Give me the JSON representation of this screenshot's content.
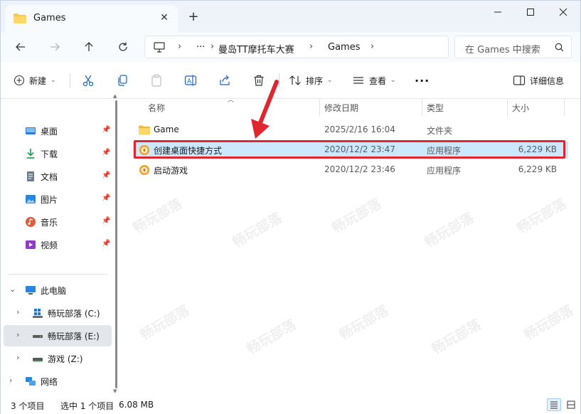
{
  "window": {
    "tab_title": "Games",
    "new_tab_label": "+",
    "close_tab_label": "✕"
  },
  "address": {
    "ellipsis": "···",
    "crumbs": [
      "曼岛TT摩托车大赛",
      "Games"
    ],
    "search_placeholder": "在 Games 中搜索"
  },
  "toolbar": {
    "new_label": "新建",
    "sort_label": "排序",
    "view_label": "查看",
    "more_label": "···",
    "details_label": "详细信息"
  },
  "sidebar": {
    "quick_access": [
      {
        "label": "桌面",
        "icon": "desktop-icon"
      },
      {
        "label": "下载",
        "icon": "download-icon"
      },
      {
        "label": "文档",
        "icon": "document-icon"
      },
      {
        "label": "图片",
        "icon": "picture-icon"
      },
      {
        "label": "音乐",
        "icon": "music-icon"
      },
      {
        "label": "视频",
        "icon": "video-icon"
      }
    ],
    "this_pc": "此电脑",
    "drives": [
      {
        "label": "畅玩部落 (C:)",
        "icon": "windows-drive-icon"
      },
      {
        "label": "畅玩部落 (E:)",
        "icon": "drive-icon"
      },
      {
        "label": "游戏 (Z:)",
        "icon": "drive-icon"
      }
    ],
    "network": "网络"
  },
  "columns": {
    "name": "名称",
    "date": "修改日期",
    "type": "类型",
    "size": "大小"
  },
  "files": [
    {
      "name": "Game",
      "date": "2025/2/16 16:04",
      "type": "文件夹",
      "size": "",
      "icon": "folder-icon"
    },
    {
      "name": "创建桌面快捷方式",
      "date": "2020/12/2 23:47",
      "type": "应用程序",
      "size": "6,229 KB",
      "icon": "app-icon"
    },
    {
      "name": "启动游戏",
      "date": "2020/12/2 23:46",
      "type": "应用程序",
      "size": "6,229 KB",
      "icon": "app-icon"
    }
  ],
  "status": {
    "item_count": "3 个项目",
    "selection": "选中 1 个项目",
    "selection_size": "6.08 MB"
  },
  "colors": {
    "accent": "#0067c0",
    "highlight_row": "#cce8ff",
    "annotation_red": "#e2262e",
    "folder_yellow": "#f7c94b",
    "app_orange": "#f0a12a"
  }
}
